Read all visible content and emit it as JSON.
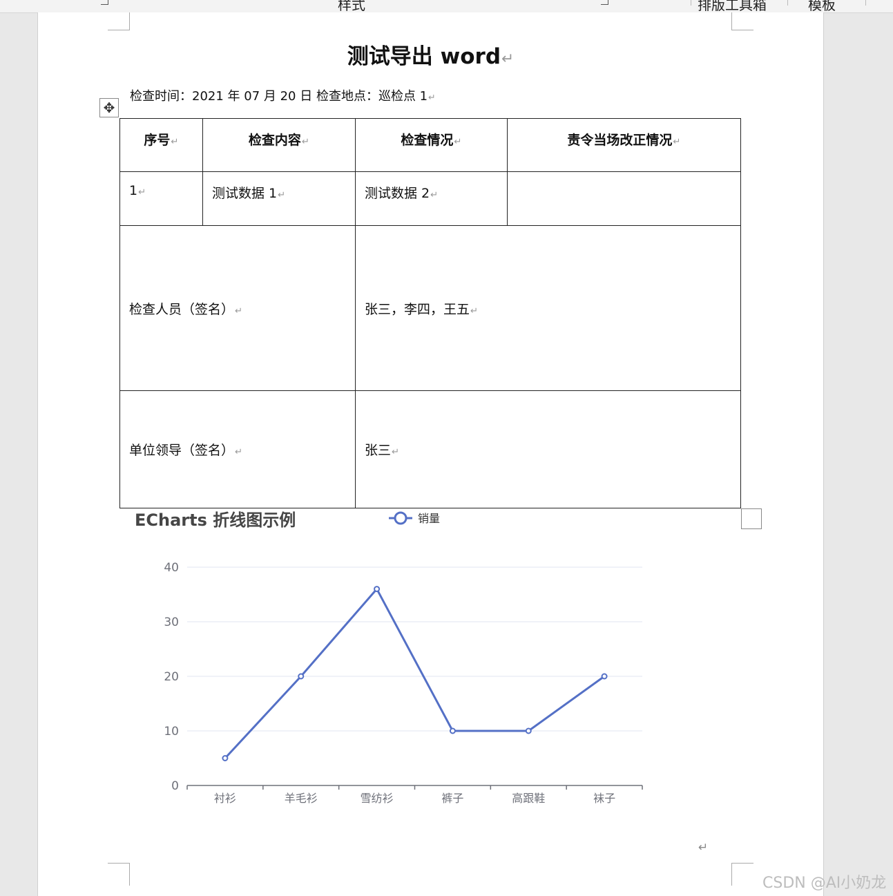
{
  "ribbon": {
    "styles_group_label": "样式",
    "typeset_toolbox_label": "排版工具箱",
    "templates_label": "模板"
  },
  "document": {
    "title": "测试导出 word",
    "paragraph_mark": "↵",
    "info_line": "检查时间：2021 年 07 月 20 日 检查地点：巡检点 1",
    "table": {
      "headers": [
        "序号",
        "检查内容",
        "检查情况",
        "责令当场改正情况"
      ],
      "row1": {
        "index": "1",
        "content": "测试数据 1",
        "status": "测试数据 2",
        "correction": ""
      },
      "inspectors_label": "检查人员（签名）",
      "inspectors_value": "张三，李四，王五",
      "leader_label": "单位领导（签名）",
      "leader_value": "张三"
    }
  },
  "chart_data": {
    "type": "line",
    "title": "ECharts 折线图示例",
    "categories": [
      "衬衫",
      "羊毛衫",
      "雪纺衫",
      "裤子",
      "高跟鞋",
      "袜子"
    ],
    "series": [
      {
        "name": "销量",
        "values": [
          5,
          20,
          36,
          10,
          10,
          20
        ]
      }
    ],
    "ylim": [
      0,
      40
    ],
    "yticks": [
      0,
      10,
      20,
      30,
      40
    ],
    "grid": true,
    "legend_position": "top-center",
    "color": "#5470c6"
  },
  "watermark": "CSDN @AI小奶龙"
}
